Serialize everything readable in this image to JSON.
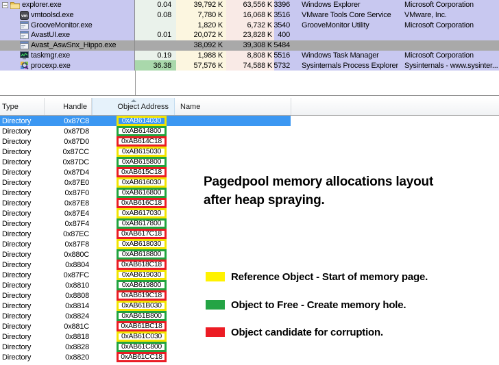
{
  "colors": {
    "box": {
      "yellow": "#F2E400",
      "green": "#21A43E",
      "red": "#EA1C24"
    },
    "handle_selected": "#3B97F2",
    "process_selected": "#A9A9A9",
    "cpu_heat": "#A9D8AB"
  },
  "process_list": {
    "rows": [
      {
        "name": "explorer.exe",
        "icon": "folder-icon",
        "expander": true,
        "child": false,
        "cpu": "0.04",
        "private_bytes": "39,792 K",
        "working_set": "63,556 K",
        "pid": "3396",
        "description": "Windows Explorer",
        "company": "Microsoft Corporation",
        "selected": false,
        "cpu_highlight": false
      },
      {
        "name": "vmtoolsd.exe",
        "icon": "vm-icon",
        "expander": false,
        "child": true,
        "cpu": "0.08",
        "private_bytes": "7,780 K",
        "working_set": "16,068 K",
        "pid": "3516",
        "description": "VMware Tools Core Service",
        "company": "VMware, Inc.",
        "selected": false,
        "cpu_highlight": false
      },
      {
        "name": "GrooveMonitor.exe",
        "icon": "window-icon",
        "expander": false,
        "child": true,
        "cpu": "",
        "private_bytes": "1,820 K",
        "working_set": "6,732 K",
        "pid": "3540",
        "description": "GrooveMonitor Utility",
        "company": "Microsoft Corporation",
        "selected": false,
        "cpu_highlight": false
      },
      {
        "name": "AvastUI.exe",
        "icon": "window-icon",
        "expander": false,
        "child": true,
        "cpu": "0.01",
        "private_bytes": "20,072 K",
        "working_set": "23,828 K",
        "pid": "400",
        "description": "",
        "company": "",
        "selected": false,
        "cpu_highlight": false
      },
      {
        "name": "Avast_AswSnx_Hippo.exe",
        "icon": "window-icon",
        "expander": false,
        "child": true,
        "cpu": "",
        "private_bytes": "38,092 K",
        "working_set": "39,308 K",
        "pid": "5484",
        "description": "",
        "company": "",
        "selected": true,
        "cpu_highlight": false
      },
      {
        "name": "taskmgr.exe",
        "icon": "taskmgr-icon",
        "expander": false,
        "child": true,
        "cpu": "0.19",
        "private_bytes": "1,988 K",
        "working_set": "8,808 K",
        "pid": "5516",
        "description": "Windows Task Manager",
        "company": "Microsoft Corporation",
        "selected": false,
        "cpu_highlight": false
      },
      {
        "name": "procexp.exe",
        "icon": "procexp-icon",
        "expander": false,
        "child": true,
        "cpu": "36.38",
        "private_bytes": "57,576 K",
        "working_set": "74,588 K",
        "pid": "5732",
        "description": "Sysinternals Process Explorer",
        "company": "Sysinternals - www.sysinter...",
        "selected": false,
        "cpu_highlight": true
      }
    ]
  },
  "handle_table": {
    "columns": {
      "type": "Type",
      "handle": "Handle",
      "object_address": "Object Address",
      "name": "Name"
    },
    "sort": {
      "column": "Object Address",
      "direction": "ascending"
    },
    "rows": [
      {
        "type": "Directory",
        "handle": "0x87C8",
        "address": "0xAB614030",
        "box": "yellow",
        "selected": true
      },
      {
        "type": "Directory",
        "handle": "0x87D8",
        "address": "0xAB614800",
        "box": "green",
        "selected": false
      },
      {
        "type": "Directory",
        "handle": "0x87D0",
        "address": "0xAB614C18",
        "box": "red",
        "selected": false
      },
      {
        "type": "Directory",
        "handle": "0x87CC",
        "address": "0xAB615030",
        "box": "yellow",
        "selected": false
      },
      {
        "type": "Directory",
        "handle": "0x87DC",
        "address": "0xAB615800",
        "box": "green",
        "selected": false
      },
      {
        "type": "Directory",
        "handle": "0x87D4",
        "address": "0xAB615C18",
        "box": "red",
        "selected": false
      },
      {
        "type": "Directory",
        "handle": "0x87E0",
        "address": "0xAB616030",
        "box": "yellow",
        "selected": false
      },
      {
        "type": "Directory",
        "handle": "0x87F0",
        "address": "0xAB616800",
        "box": "green",
        "selected": false
      },
      {
        "type": "Directory",
        "handle": "0x87E8",
        "address": "0xAB616C18",
        "box": "red",
        "selected": false
      },
      {
        "type": "Directory",
        "handle": "0x87E4",
        "address": "0xAB617030",
        "box": "yellow",
        "selected": false
      },
      {
        "type": "Directory",
        "handle": "0x87F4",
        "address": "0xAB617800",
        "box": "green",
        "selected": false
      },
      {
        "type": "Directory",
        "handle": "0x87EC",
        "address": "0xAB617C18",
        "box": "red",
        "selected": false
      },
      {
        "type": "Directory",
        "handle": "0x87F8",
        "address": "0xAB618030",
        "box": "yellow",
        "selected": false
      },
      {
        "type": "Directory",
        "handle": "0x880C",
        "address": "0xAB618800",
        "box": "green",
        "selected": false
      },
      {
        "type": "Directory",
        "handle": "0x8804",
        "address": "0xAB618C18",
        "box": "red",
        "selected": false
      },
      {
        "type": "Directory",
        "handle": "0x87FC",
        "address": "0xAB619030",
        "box": "yellow",
        "selected": false
      },
      {
        "type": "Directory",
        "handle": "0x8810",
        "address": "0xAB619800",
        "box": "green",
        "selected": false
      },
      {
        "type": "Directory",
        "handle": "0x8808",
        "address": "0xAB619C18",
        "box": "red",
        "selected": false
      },
      {
        "type": "Directory",
        "handle": "0x8814",
        "address": "0xAB61B030",
        "box": "yellow",
        "selected": false
      },
      {
        "type": "Directory",
        "handle": "0x8824",
        "address": "0xAB61B800",
        "box": "green",
        "selected": false
      },
      {
        "type": "Directory",
        "handle": "0x881C",
        "address": "0xAB61BC18",
        "box": "red",
        "selected": false
      },
      {
        "type": "Directory",
        "handle": "0x8818",
        "address": "0xAB61C030",
        "box": "yellow",
        "selected": false
      },
      {
        "type": "Directory",
        "handle": "0x8828",
        "address": "0xAB61C800",
        "box": "green",
        "selected": false
      },
      {
        "type": "Directory",
        "handle": "0x8820",
        "address": "0xAB61CC18",
        "box": "red",
        "selected": false
      }
    ]
  },
  "annotation": {
    "title_line1": "Pagedpool memory allocations layout",
    "title_line2": "after heap spraying.",
    "legend": [
      {
        "color": "#FFF200",
        "label": "Reference Object - Start of memory page."
      },
      {
        "color": "#24A445",
        "label": "Object to Free - Create memory hole."
      },
      {
        "color": "#EC1C24",
        "label": "Object candidate for corruption."
      }
    ]
  }
}
